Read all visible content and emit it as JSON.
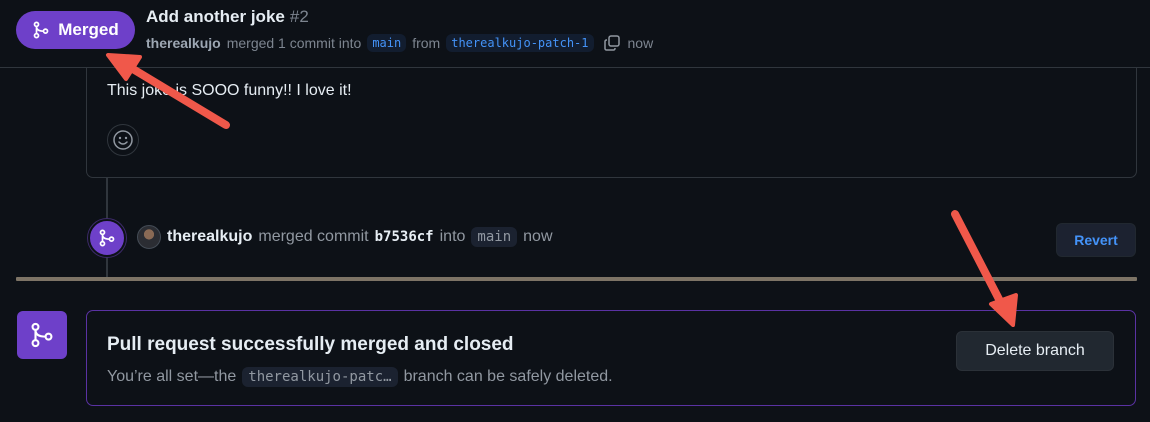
{
  "header": {
    "status_badge": "Merged",
    "title": "Add another joke",
    "number": "#2",
    "author": "therealkujo",
    "action_text": "merged 1 commit into",
    "base_branch": "main",
    "from_text": "from",
    "head_branch": "therealkujo-patch-1",
    "time": "now"
  },
  "comment": {
    "body": "This joke is SOOO funny!! I love it!"
  },
  "merge_event": {
    "user": "therealkujo",
    "action": "merged commit",
    "sha": "b7536cf",
    "into": "into",
    "branch": "main",
    "time": "now",
    "revert_label": "Revert"
  },
  "merge_status": {
    "title": "Pull request successfully merged and closed",
    "desc_prefix": "You’re all set—the",
    "branch": "therealkujo-patc…",
    "desc_suffix": "branch can be safely deleted.",
    "delete_label": "Delete branch"
  },
  "colors": {
    "merged_purple": "#6e40c9",
    "link_blue": "#4493f8",
    "annotation_arrow": "#f0584a",
    "background": "#0d1117"
  }
}
